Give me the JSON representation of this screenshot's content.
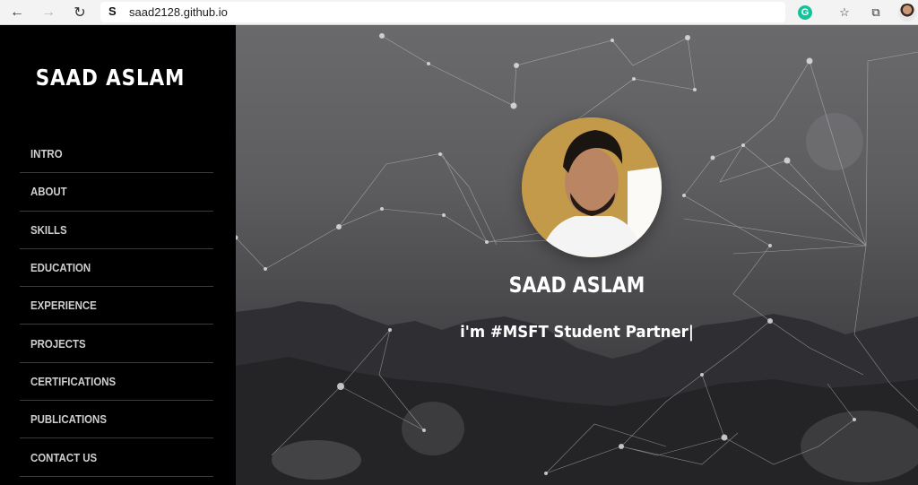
{
  "browser": {
    "url": "saad2128.github.io",
    "site_icon": "S",
    "back_icon": "←",
    "forward_icon": "→",
    "reload_icon": "↻",
    "grammarly_icon": "G",
    "favorites_icon": "☆",
    "collections_icon": "⧉"
  },
  "sidebar": {
    "brand": "SAAD ASLAM",
    "items": [
      {
        "label": "INTRO"
      },
      {
        "label": "ABOUT"
      },
      {
        "label": "SKILLS"
      },
      {
        "label": "EDUCATION"
      },
      {
        "label": "EXPERIENCE"
      },
      {
        "label": "PROJECTS"
      },
      {
        "label": "CERTIFICATIONS"
      },
      {
        "label": "PUBLICATIONS"
      },
      {
        "label": "CONTACT US"
      }
    ]
  },
  "hero": {
    "name": "SAAD ASLAM",
    "tagline": "i'm #MSFT Student Partner|"
  }
}
